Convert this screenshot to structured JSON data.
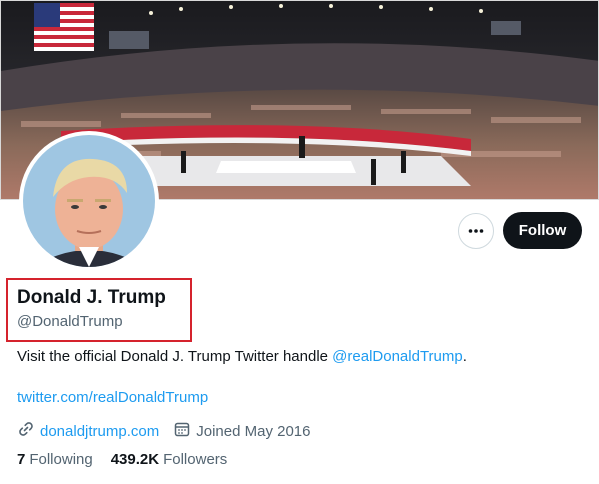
{
  "banner": {
    "image": "rally-arena-photo"
  },
  "avatar": {
    "image": "profile-photo"
  },
  "actions": {
    "more_icon": "ellipsis-icon",
    "follow_label": "Follow"
  },
  "profile": {
    "display_name": "Donald J. Trump",
    "handle": "@DonaldTrump",
    "bio_text": "Visit the official Donald J. Trump Twitter handle ",
    "bio_mention": "@realDonaldTrump",
    "bio_end": ".",
    "bio_link": "twitter.com/realDonaldTrump",
    "website": "donaldjtrump.com",
    "joined": "Joined May 2016"
  },
  "stats": {
    "following_count": "7",
    "following_label": "Following",
    "followers_count": "439.2K",
    "followers_label": "Followers"
  },
  "colors": {
    "accent": "#1d9bf0",
    "highlight_box": "#d5232d",
    "follow_bg": "#0f1419"
  }
}
